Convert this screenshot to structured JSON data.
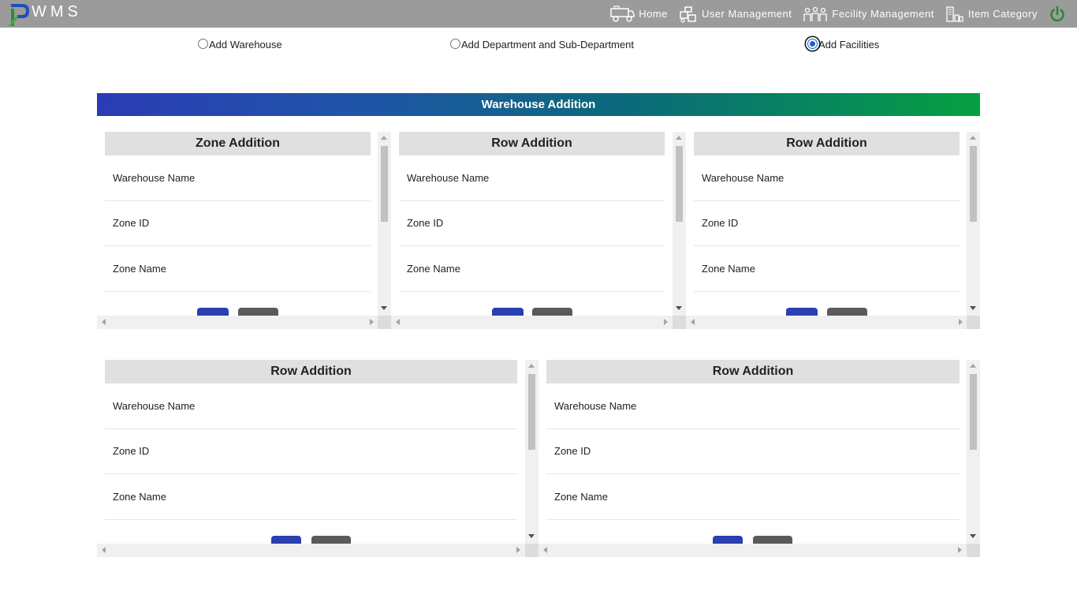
{
  "app": {
    "logo_text": "WMS"
  },
  "nav": {
    "items": [
      {
        "label": "Home",
        "icon": "home-vehicle-icon"
      },
      {
        "label": "User Management",
        "icon": "user-management-icon"
      },
      {
        "label": "Fecility Management",
        "icon": "facility-management-icon"
      },
      {
        "label": "Item Category",
        "icon": "item-category-icon"
      }
    ],
    "power_icon": "power-icon",
    "power_color": "#1f8a2a"
  },
  "radios": [
    {
      "label": "Add Warehouse",
      "checked": false
    },
    {
      "label": "Add Department and Sub-Department",
      "checked": false
    },
    {
      "label": "Add Facilities",
      "checked": true
    }
  ],
  "section": {
    "title": "Warehouse Addition"
  },
  "panels": [
    {
      "title": "Zone Addition",
      "fields": [
        "Warehouse Name",
        "Zone ID",
        "Zone Name"
      ]
    },
    {
      "title": "Row Addition",
      "fields": [
        "Warehouse Name",
        "Zone ID",
        "Zone Name"
      ]
    },
    {
      "title": "Row Addition",
      "fields": [
        "Warehouse Name",
        "Zone ID",
        "Zone Name"
      ]
    },
    {
      "title": "Row Addition",
      "fields": [
        "Warehouse Name",
        "Zone ID",
        "Zone Name"
      ]
    },
    {
      "title": "Row Addition",
      "fields": [
        "Warehouse Name",
        "Zone ID",
        "Zone Name"
      ]
    }
  ],
  "colors": {
    "topbar": "#9b9b9b",
    "gradient_start": "#2a3cb4",
    "gradient_end": "#06a040",
    "primary_button": "#2a3fb0",
    "secondary_button": "#5a5a5a"
  }
}
